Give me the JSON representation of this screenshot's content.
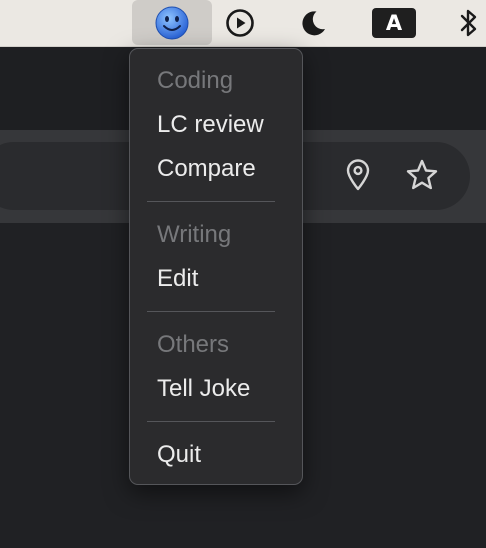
{
  "menubar": {
    "items": [
      {
        "name": "finder-smiley",
        "icon": "smiley-face-icon"
      },
      {
        "name": "playback",
        "icon": "play-circle-icon"
      },
      {
        "name": "appearance",
        "icon": "moon-icon"
      },
      {
        "name": "input-source",
        "label": "A"
      },
      {
        "name": "bluetooth",
        "icon": "bluetooth-icon"
      }
    ],
    "input_source_label": "A"
  },
  "toolbar": {
    "icons": [
      "location-pin-icon",
      "star-icon"
    ]
  },
  "menu": {
    "sections": [
      {
        "header": "Coding",
        "items": [
          "LC review",
          "Compare"
        ]
      },
      {
        "header": "Writing",
        "items": [
          "Edit"
        ]
      },
      {
        "header": "Others",
        "items": [
          "Tell Joke"
        ]
      }
    ],
    "quit_label": "Quit"
  },
  "colors": {
    "menubar_bg": "#ebe8e3",
    "menu_bg": "#2b2b2d",
    "menu_text": "#ececec",
    "menu_header_text": "#77787b",
    "browser_bg": "#202124",
    "smiley_blue": "#3a7be0"
  }
}
